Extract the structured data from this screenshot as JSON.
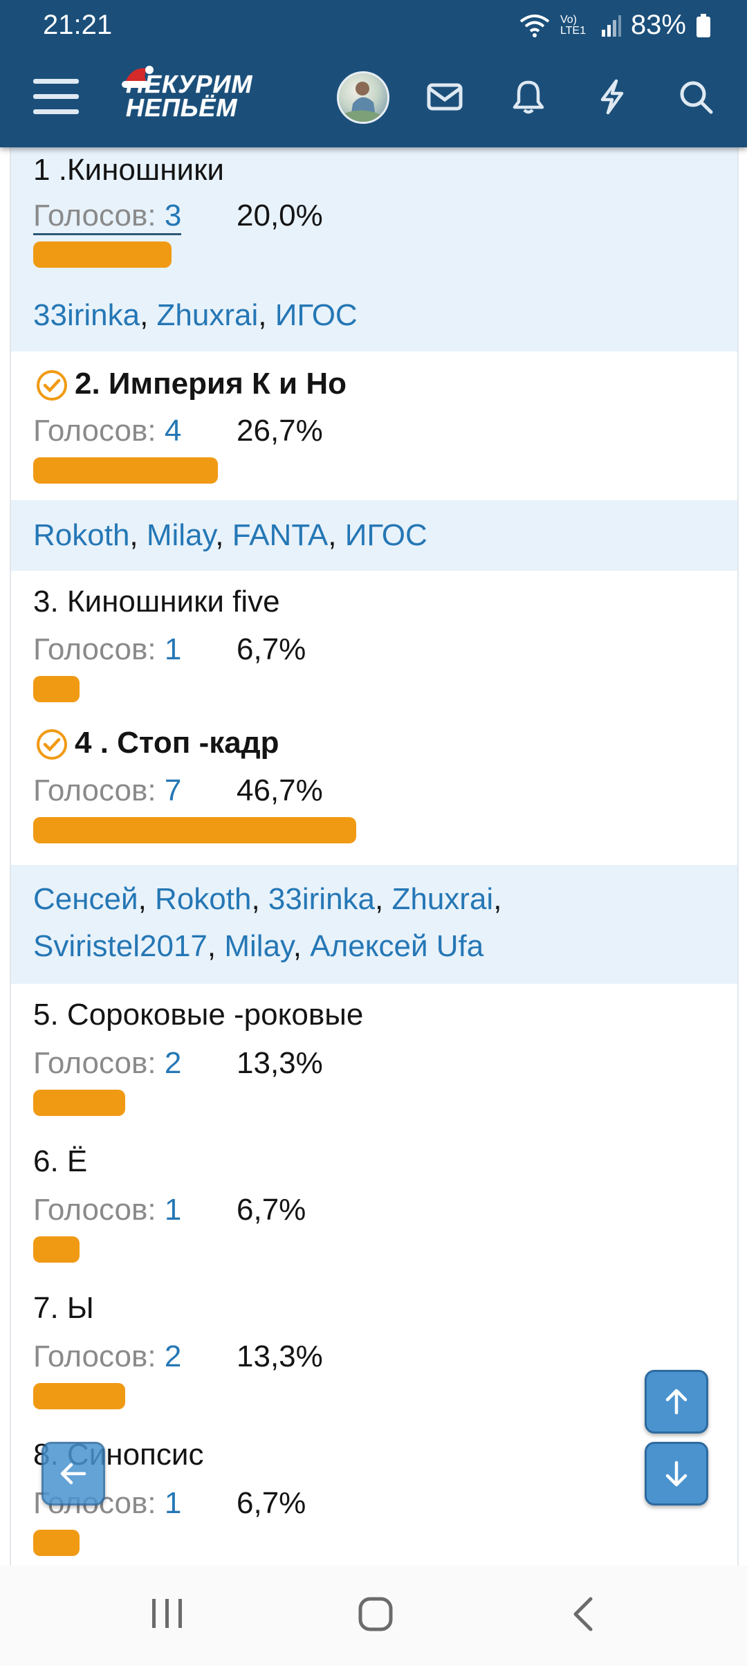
{
  "status_bar": {
    "time": "21:21",
    "network": "Vo) LTE1",
    "battery": "83%"
  },
  "header": {
    "logo_line1": "НЕКУРИМ",
    "logo_line2": "НЕПЬЁМ",
    "icons": [
      "menu-icon",
      "avatar",
      "mail-icon",
      "bell-icon",
      "lightning-icon",
      "search-icon"
    ]
  },
  "poll": {
    "options": [
      {
        "title": "1 .Киношники",
        "votes_label": "Голосов: ",
        "votes": "3",
        "percent": "20,0%",
        "share": 0.2,
        "voted": false,
        "voters": [
          "33irinka",
          "Zhuxrai",
          "ИГОС"
        ]
      },
      {
        "title": "2. Империя К и Но",
        "votes_label": "Голосов: ",
        "votes": "4",
        "percent": "26,7%",
        "share": 0.267,
        "voted": true,
        "voters": [
          "Rokoth",
          "Milay",
          "FANTA",
          "ИГОС"
        ]
      },
      {
        "title": "3. Киношники five",
        "votes_label": "Голосов: ",
        "votes": "1",
        "percent": "6,7%",
        "share": 0.067,
        "voted": false,
        "voters": []
      },
      {
        "title": "4 . Стоп -кадр",
        "votes_label": "Голосов: ",
        "votes": "7",
        "percent": "46,7%",
        "share": 0.467,
        "voted": true,
        "voters": [
          "Сенсей",
          "Rokoth",
          "33irinka",
          "Zhuxrai",
          "Sviristel2017",
          "Milay",
          "Алексей Ufa"
        ]
      },
      {
        "title": "5. Сороковые -роковые",
        "votes_label": "Голосов: ",
        "votes": "2",
        "percent": "13,3%",
        "share": 0.133,
        "voted": false,
        "voters": []
      },
      {
        "title": "6. Ё",
        "votes_label": "Голосов: ",
        "votes": "1",
        "percent": "6,7%",
        "share": 0.067,
        "voted": false,
        "voters": []
      },
      {
        "title": "7. Ы",
        "votes_label": "Голосов: ",
        "votes": "2",
        "percent": "13,3%",
        "share": 0.133,
        "voted": false,
        "voters": []
      },
      {
        "title": "8. Синопсис",
        "votes_label": "Голосов: ",
        "votes": "1",
        "percent": "6,7%",
        "share": 0.067,
        "voted": false,
        "voters": []
      }
    ]
  },
  "colors": {
    "header_bg": "#1b4f7a",
    "bar": "#f09a14",
    "link": "#2577b5",
    "highlight_bg": "#e8f2fb",
    "fab": "#4a93cf"
  }
}
